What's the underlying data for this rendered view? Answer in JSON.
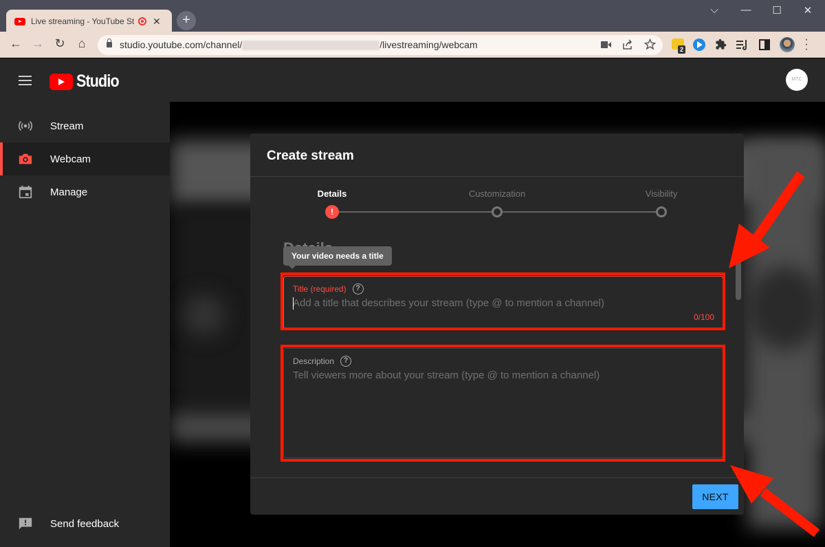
{
  "browser": {
    "tab": {
      "title": "Live streaming - YouTube Studio",
      "close_glyph": "✕",
      "recording_indicator": true
    },
    "new_tab_glyph": "+",
    "window_controls": {
      "tab_search": "⌵",
      "minimize": "—",
      "maximize": "☐",
      "close": "✕"
    },
    "nav": {
      "back": "←",
      "forward": "→",
      "reload": "↻",
      "home": "⌂"
    },
    "address": {
      "prefix": "studio.youtube.com/channel/",
      "redacted": true,
      "suffix": "/livestreaming/webcam"
    },
    "omnibox_icons": [
      "camera-icon",
      "share-icon",
      "star-icon"
    ],
    "extensions": {
      "badge_count": "2",
      "icons": [
        "notes-extension-icon",
        "media-extension-icon",
        "puzzle-icon",
        "reading-list-icon",
        "side-panel-icon",
        "profile-avatar",
        "menu-icon"
      ]
    }
  },
  "studio": {
    "logo_text": "Studio",
    "avatar_text": "MTC"
  },
  "sidebar": {
    "items": [
      {
        "label": "Stream",
        "icon": "broadcast-icon",
        "active": false
      },
      {
        "label": "Webcam",
        "icon": "camera-icon",
        "active": true
      },
      {
        "label": "Manage",
        "icon": "calendar-icon",
        "active": false
      }
    ],
    "feedback": {
      "label": "Send feedback",
      "icon": "feedback-icon"
    }
  },
  "dialog": {
    "title": "Create stream",
    "steps": [
      {
        "label": "Details",
        "state": "error"
      },
      {
        "label": "Customization",
        "state": "pending"
      },
      {
        "label": "Visibility",
        "state": "pending"
      }
    ],
    "error_glyph": "!",
    "section_heading": "Details",
    "tooltip": "Your video needs a title",
    "title_field": {
      "label": "Title (required)",
      "placeholder": "Add a title that describes your stream (type @ to mention a channel)",
      "value": "",
      "counter": "0/100"
    },
    "description_field": {
      "label": "Description",
      "placeholder": "Tell viewers more about your stream (type @ to mention a channel)",
      "value": ""
    },
    "help_glyph": "?",
    "next_label": "NEXT"
  },
  "colors": {
    "accent_red": "#ff4e45",
    "annotation_red": "#ff1a00",
    "next_blue": "#3ea6ff",
    "surface": "#282828"
  }
}
